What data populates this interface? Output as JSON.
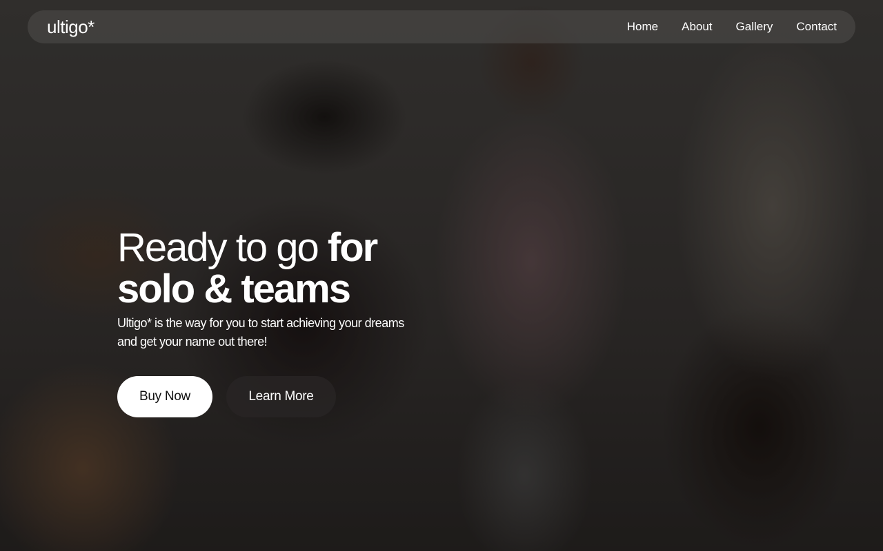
{
  "brand": {
    "logo_text": "ultigo*"
  },
  "nav": {
    "items": [
      {
        "label": "Home"
      },
      {
        "label": "About"
      },
      {
        "label": "Gallery"
      },
      {
        "label": "Contact"
      }
    ]
  },
  "hero": {
    "headline_light": "Ready to go ",
    "headline_bold_1": "for",
    "headline_bold_2": "solo & teams",
    "subtext": "Ultigo* is the way for you to start achieving your dreams and get your name out there!",
    "buttons": {
      "primary_label": "Buy Now",
      "secondary_label": "Learn More"
    }
  },
  "colors": {
    "primary_button_bg": "#ffffff",
    "secondary_button_bg": "#282424",
    "text": "#ffffff"
  }
}
